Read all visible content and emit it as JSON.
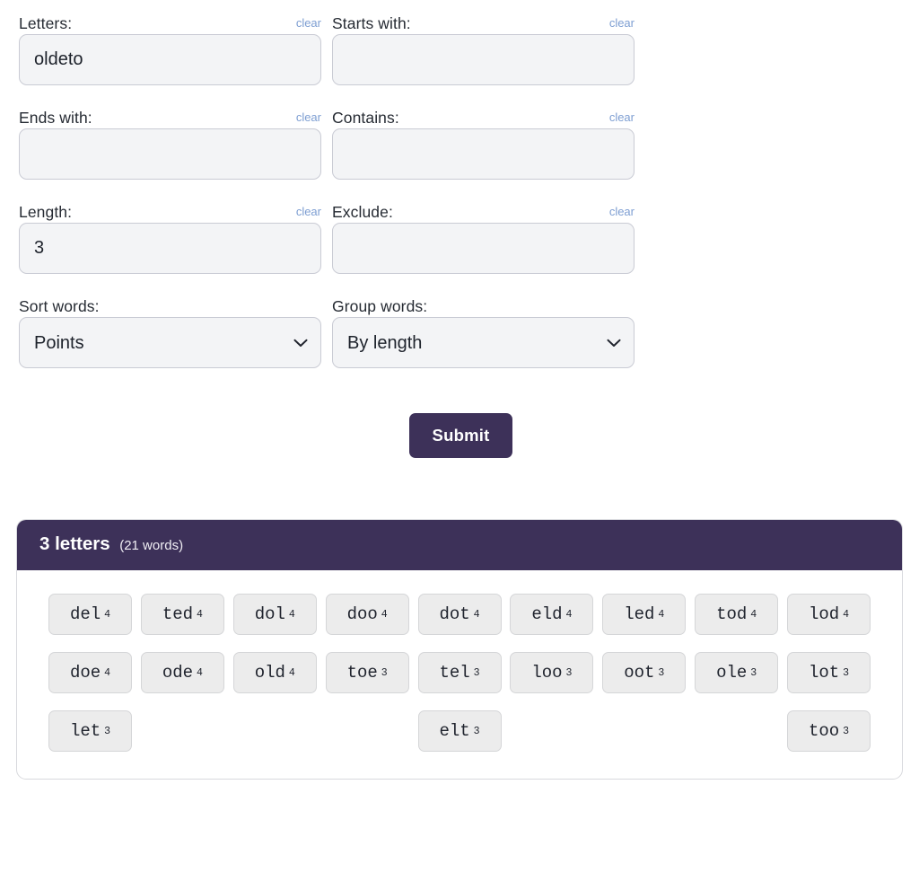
{
  "theme": {
    "accent": "#3d3159",
    "link": "#7d9ed2",
    "input_bg": "#f3f4f6",
    "input_border": "#c9cbd4",
    "chip_bg": "#ececec",
    "chip_border": "#d5d6d8",
    "panel_border": "#d8d9dd"
  },
  "form": {
    "clear_label": "clear",
    "fields": [
      {
        "key": "letters",
        "label": "Letters:",
        "value": "oldeto",
        "placeholder": "",
        "has_clear": true
      },
      {
        "key": "starts_with",
        "label": "Starts with:",
        "value": "",
        "placeholder": "",
        "has_clear": true
      },
      {
        "key": "ends_with",
        "label": "Ends with:",
        "value": "",
        "placeholder": "",
        "has_clear": true
      },
      {
        "key": "contains",
        "label": "Contains:",
        "value": "",
        "placeholder": "",
        "has_clear": true
      },
      {
        "key": "length",
        "label": "Length:",
        "value": "3",
        "placeholder": "",
        "has_clear": true
      },
      {
        "key": "exclude",
        "label": "Exclude:",
        "value": "",
        "placeholder": "",
        "has_clear": true
      }
    ],
    "selects": [
      {
        "key": "sort_words",
        "label": "Sort words:",
        "value": "Points",
        "options": [
          "Points",
          "Alphabetically",
          "Length"
        ]
      },
      {
        "key": "group_words",
        "label": "Group words:",
        "value": "By length",
        "options": [
          "By length",
          "No grouping"
        ]
      }
    ],
    "submit_label": "Submit"
  },
  "results": {
    "group_title": "3 letters",
    "group_count": "(21 words)",
    "words": [
      {
        "word": "del",
        "points": "4"
      },
      {
        "word": "ted",
        "points": "4"
      },
      {
        "word": "dol",
        "points": "4"
      },
      {
        "word": "doo",
        "points": "4"
      },
      {
        "word": "dot",
        "points": "4"
      },
      {
        "word": "eld",
        "points": "4"
      },
      {
        "word": "led",
        "points": "4"
      },
      {
        "word": "tod",
        "points": "4"
      },
      {
        "word": "lod",
        "points": "4"
      },
      {
        "word": "doe",
        "points": "4"
      },
      {
        "word": "ode",
        "points": "4"
      },
      {
        "word": "old",
        "points": "4"
      },
      {
        "word": "toe",
        "points": "3"
      },
      {
        "word": "tel",
        "points": "3"
      },
      {
        "word": "loo",
        "points": "3"
      },
      {
        "word": "oot",
        "points": "3"
      },
      {
        "word": "ole",
        "points": "3"
      },
      {
        "word": "lot",
        "points": "3"
      },
      {
        "word": "let",
        "points": "3"
      },
      {
        "word": "elt",
        "points": "3"
      },
      {
        "word": "too",
        "points": "3"
      }
    ]
  }
}
